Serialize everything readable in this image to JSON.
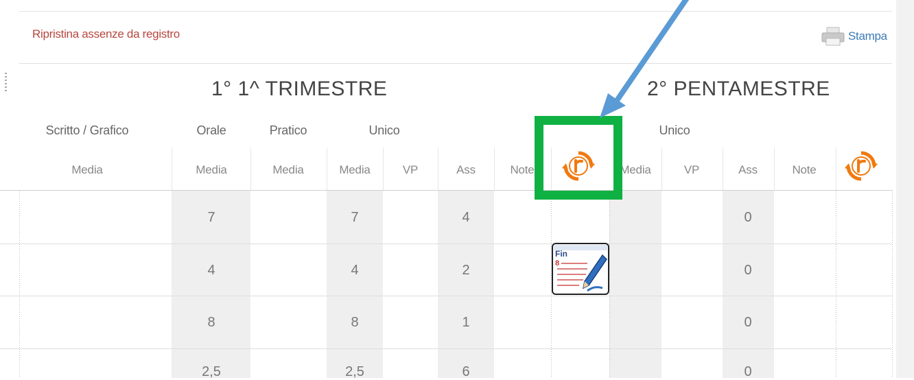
{
  "toolbar": {
    "restore_link": "Ripristina assenze da registro",
    "print_label": "Stampa"
  },
  "terms": [
    {
      "title": "1° 1^ TRIMESTRE"
    },
    {
      "title": "2° PENTAMESTRE"
    }
  ],
  "term1": {
    "groups": [
      "Scritto / Grafico",
      "Orale",
      "Pratico",
      "Unico"
    ],
    "subheaders": [
      "Media",
      "Media",
      "Media",
      "Media",
      "VP",
      "Ass",
      "Note"
    ]
  },
  "term2": {
    "groups": [
      "Unico"
    ],
    "subheaders": [
      "Media",
      "VP",
      "Ass",
      "Note"
    ]
  },
  "rows": [
    {
      "orale_media": "7",
      "unico_media": "7",
      "ass1": "4",
      "ass2": "0"
    },
    {
      "orale_media": "4",
      "unico_media": "4",
      "ass1": "2",
      "ass2": "0"
    },
    {
      "orale_media": "8",
      "unico_media": "8",
      "ass1": "1",
      "ass2": "0"
    },
    {
      "orale_media": "2,5",
      "unico_media": "2,5",
      "ass1": "6",
      "ass2": "0"
    }
  ],
  "icons": {
    "restore": "restore-r-icon",
    "print": "printer-icon",
    "final": "fin-document-icon"
  },
  "fin_icon_text": {
    "label": "Fin",
    "number": "8"
  },
  "colors": {
    "highlight": "#10b143",
    "arrow": "#5b9bd5",
    "restore_icon": "#f07a10",
    "link": "#b5473f"
  }
}
